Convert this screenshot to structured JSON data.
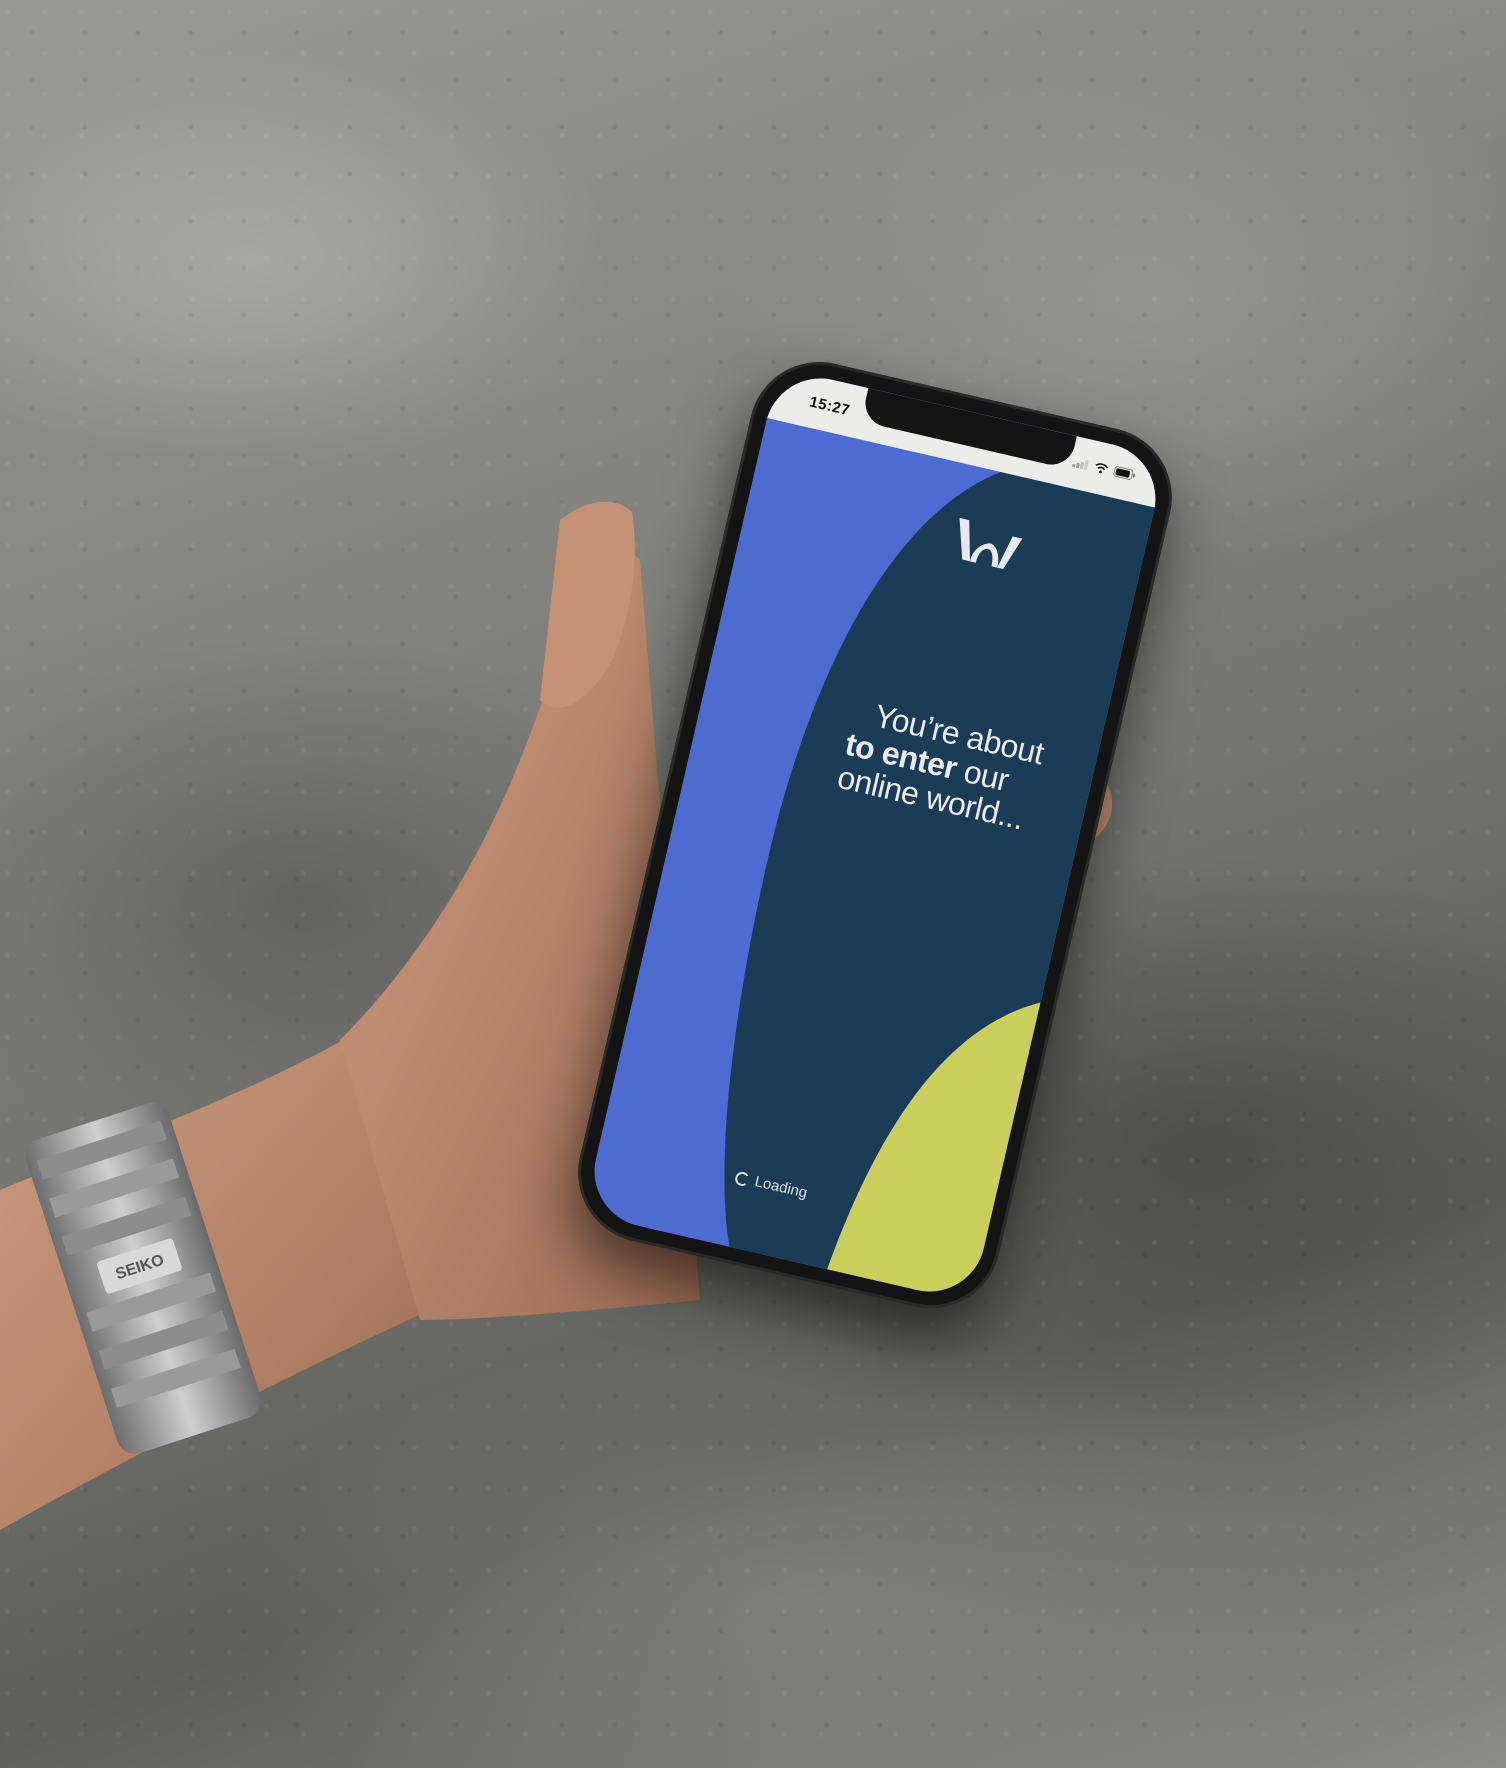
{
  "status_bar": {
    "time": "15:27",
    "icons": [
      "signal-icon",
      "wifi-icon",
      "battery-icon"
    ]
  },
  "screen": {
    "headline": {
      "line1": "You’re about",
      "line2_bold": "to enter",
      "line2_rest": " our",
      "line3": "online world..."
    },
    "loading_label": "Loading"
  },
  "colors": {
    "screen_blue": "#4d6bd0",
    "screen_navy": "#1a3c56",
    "screen_lime": "#c8cf5a",
    "status_bar": "#ececea"
  },
  "scene": {
    "watch_brand": "SEIKO"
  }
}
